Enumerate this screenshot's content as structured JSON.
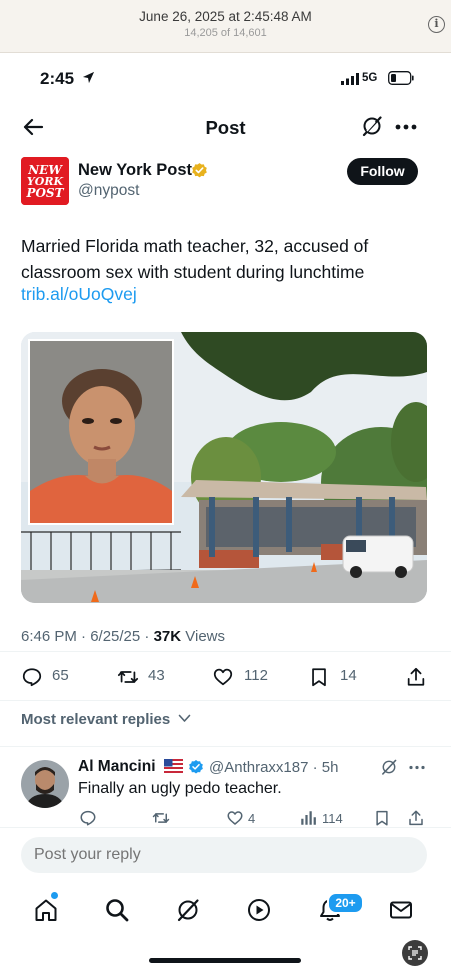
{
  "viewer": {
    "date": "June 26, 2025 at 2:45:48 AM",
    "count": "14,205 of 14,601",
    "info_icon": "info-icon"
  },
  "status_bar": {
    "time": "2:45",
    "network": "5G",
    "icons": [
      "location-arrow-icon",
      "signal-icon",
      "battery-icon"
    ]
  },
  "nav": {
    "title": "Post",
    "icons": [
      "back-arrow-icon",
      "grok-icon",
      "more-icon"
    ]
  },
  "author": {
    "name": "New York Post",
    "handle": "@nypost",
    "logo_lines": [
      "NEW",
      "YORK",
      "POST"
    ],
    "follow_label": "Follow",
    "verified": "gold"
  },
  "post": {
    "text": "Married Florida math teacher, 32, accused of classroom sex with student during lunchtime",
    "link": "trib.al/oUoQvej",
    "time": "6:46 PM · 6/25/25 · ",
    "views_count": "37K",
    "views_label": " Views"
  },
  "actions": {
    "replies": "65",
    "reposts": "43",
    "likes": "112",
    "bookmarks": "14"
  },
  "replies_sort": {
    "label": "Most relevant replies"
  },
  "reply": {
    "name": "Al Mancini",
    "flag": "US flag",
    "handle": "@Anthraxx187",
    "time": "· 5h",
    "text": "Finally an ugly pedo teacher.",
    "counts": {
      "likes": "4",
      "views": "114"
    }
  },
  "composer": {
    "placeholder": "Post your reply"
  },
  "tabs": {
    "notifications_badge": "20+",
    "items": [
      "home-icon",
      "search-icon",
      "grok-icon",
      "video-icon",
      "notifications-icon",
      "messages-icon"
    ]
  },
  "colors": {
    "accent": "#1d9bf0",
    "text": "#0f1419",
    "secondary": "#536471",
    "brand_red": "#e11b22"
  }
}
